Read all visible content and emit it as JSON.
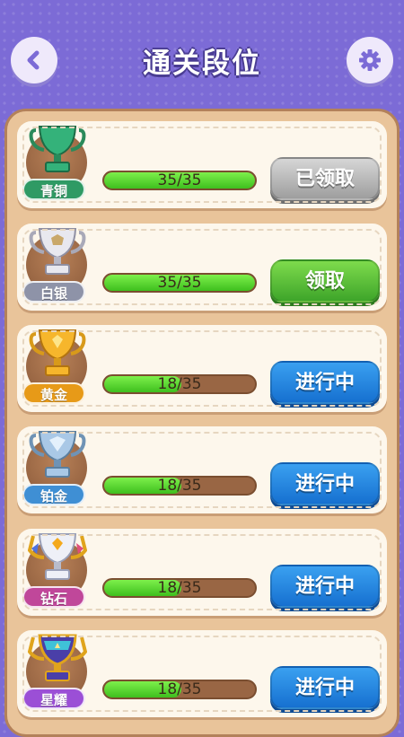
{
  "header": {
    "title": "通关段位"
  },
  "icons": {
    "back": "chevron-left-icon",
    "settings": "gear-icon"
  },
  "colors": {
    "background": "#7c6bd6",
    "panel": "#e9c49a",
    "claimed": "#9e9e9e",
    "claim": "#3ea52a",
    "in_progress": "#1670d0"
  },
  "ranks": [
    {
      "name": "青铜",
      "progress": "35/35",
      "fill": 1.0,
      "action": "已领取",
      "state": "claimed",
      "tier": "bronze"
    },
    {
      "name": "白银",
      "progress": "35/35",
      "fill": 1.0,
      "action": "领取",
      "state": "claim",
      "tier": "silver"
    },
    {
      "name": "黄金",
      "progress": "18/35",
      "fill": 0.514,
      "action": "进行中",
      "state": "progress",
      "tier": "gold"
    },
    {
      "name": "铂金",
      "progress": "18/35",
      "fill": 0.514,
      "action": "进行中",
      "state": "progress",
      "tier": "platinum"
    },
    {
      "name": "钻石",
      "progress": "18/35",
      "fill": 0.514,
      "action": "进行中",
      "state": "progress",
      "tier": "diamond"
    },
    {
      "name": "星耀",
      "progress": "18/35",
      "fill": 0.514,
      "action": "进行中",
      "state": "progress",
      "tier": "star"
    }
  ]
}
